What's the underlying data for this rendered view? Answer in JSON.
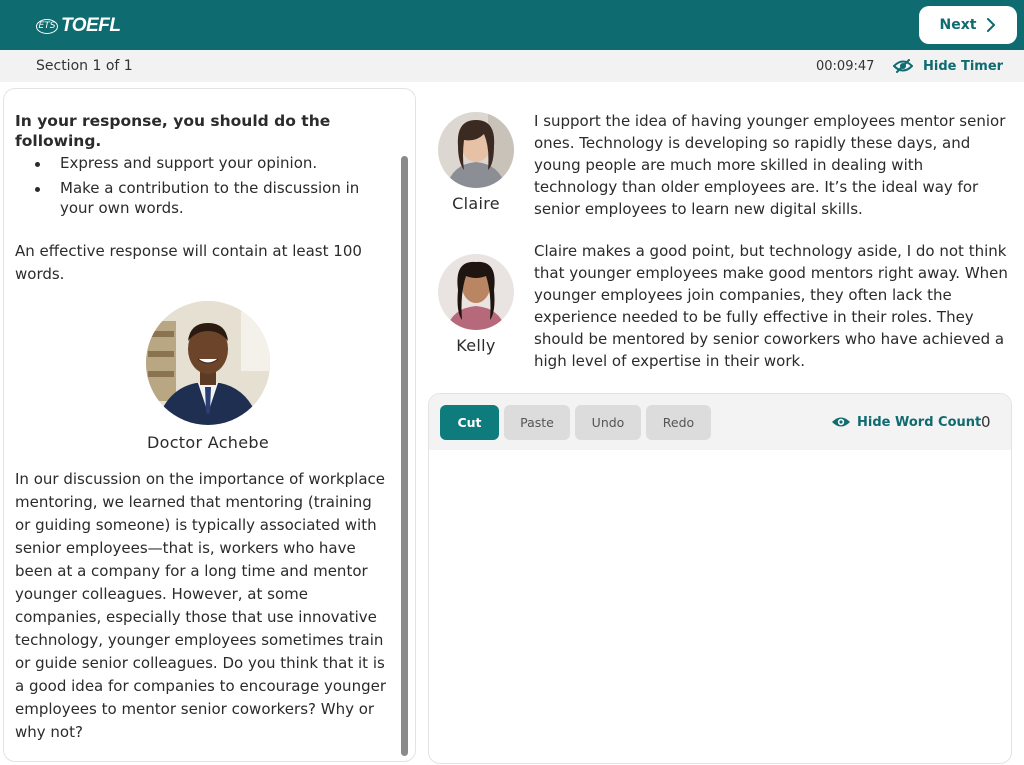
{
  "header": {
    "logo_ets": "ETS",
    "logo_text": "TOEFL",
    "next_label": "Next"
  },
  "section_bar": {
    "section_label": "Section 1 of 1",
    "timer": "00:09:47",
    "hide_timer_label": "Hide Timer"
  },
  "left_panel": {
    "instructions_title": "In your response, you should do the following.",
    "bullets": [
      "Express and support your opinion.",
      "Make a contribution to the discussion in your own words."
    ],
    "effective_note": "An effective response will contain at least 100 words.",
    "professor_name": "Doctor Achebe",
    "professor_prompt": "In our discussion on the importance of workplace mentoring, we learned that mentoring (training or guiding someone) is typically associated with senior employees—that is, workers who have been at a company for a long time and mentor younger colleagues. However, at some companies, especially those that use innovative technology, younger employees sometimes train or guide senior colleagues. Do you think that it is a good idea for companies to encourage younger employees to mentor senior coworkers? Why or why not?"
  },
  "students": [
    {
      "name": "Claire",
      "text": "I support the idea of having younger employees mentor senior ones. Technology is developing so rapidly these days, and young people are much more skilled in dealing with technology than older employees are. It’s the ideal way for senior employees to learn new digital skills."
    },
    {
      "name": "Kelly",
      "text": "Claire makes a good point, but technology aside, I do not think that younger employees make good mentors right away. When younger employees join companies, they often lack the experience needed to be fully effective in their roles. They should be mentored by senior coworkers who have achieved a high level of expertise in their work."
    }
  ],
  "editor": {
    "cut_label": "Cut",
    "paste_label": "Paste",
    "undo_label": "Undo",
    "redo_label": "Redo",
    "hide_word_count_label": "Hide Word Count",
    "word_count": "0",
    "value": ""
  },
  "colors": {
    "brand_teal": "#0e6b6f",
    "button_teal": "#0e7b7d",
    "section_bar_bg": "#f2f2f2",
    "toolbar_button_gray": "#dcdcdc"
  },
  "icons": {
    "next": "chevron-right-icon",
    "hide_timer": "eye-slash-icon",
    "hide_word_count": "eye-icon"
  }
}
